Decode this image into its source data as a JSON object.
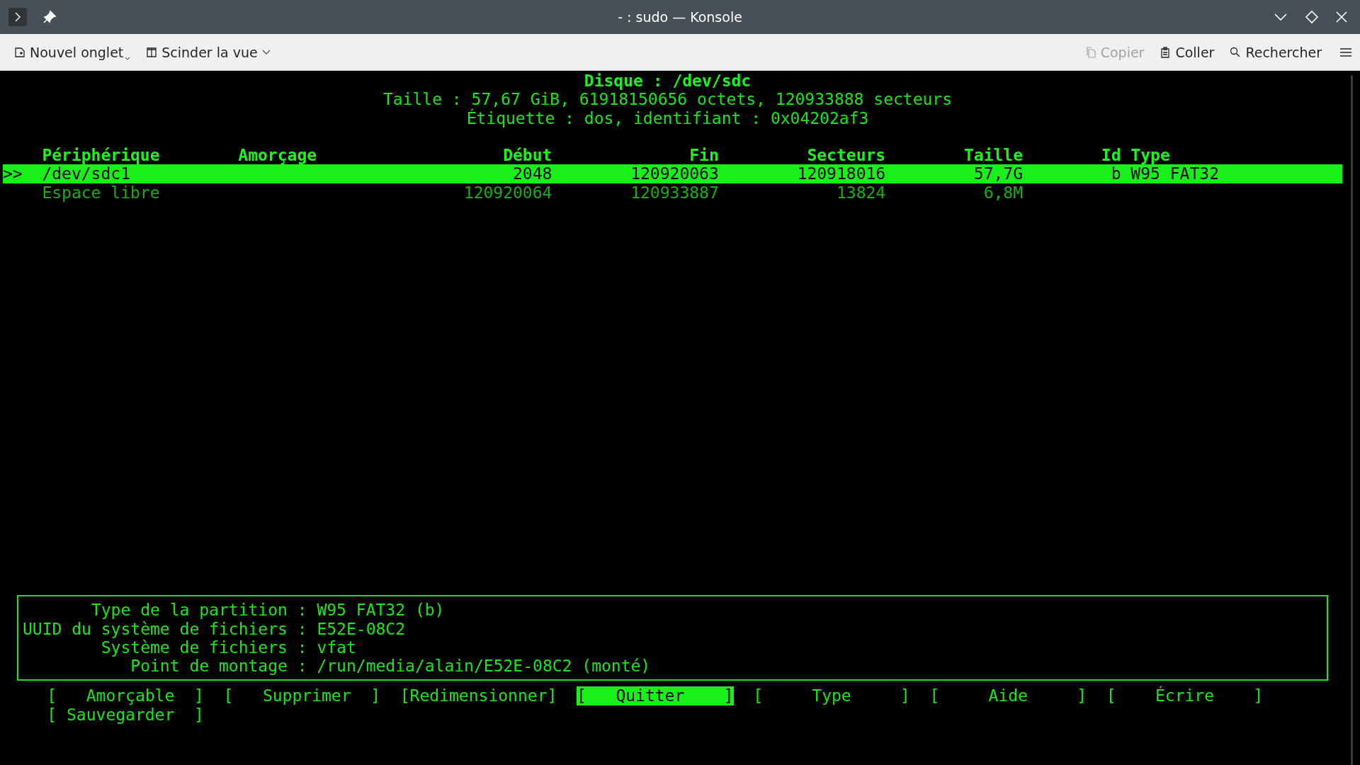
{
  "window": {
    "title": "- : sudo — Konsole"
  },
  "toolbar": {
    "left": [
      {
        "kind": "new-tab",
        "label": "Nouvel onglet",
        "disabled": false
      },
      {
        "kind": "split",
        "label": "Scinder la vue",
        "disabled": false
      }
    ],
    "right": [
      {
        "kind": "copy",
        "label": "Copier",
        "disabled": true
      },
      {
        "kind": "paste",
        "label": "Coller",
        "disabled": false
      },
      {
        "kind": "search",
        "label": "Rechercher",
        "disabled": false
      }
    ]
  },
  "disk": {
    "title": "Disque : /dev/sdc",
    "lines": [
      "Taille : 57,67 GiB, 61918150656 octets, 120933888 secteurs",
      "Étiquette : dos, identifiant : 0x04202af3"
    ]
  },
  "table": {
    "cursor": ">>",
    "columns": [
      "Périphérique",
      "Amorçage",
      "Début",
      "Fin",
      "Secteurs",
      "Taille",
      "Id",
      "Type"
    ],
    "rows": [
      {
        "kind": "partition",
        "selected": true,
        "device": "/dev/sdc1",
        "start": "2048",
        "end": "120920063",
        "sectors": "120918016",
        "size": "57,7G",
        "id": "b",
        "type": "W95 FAT32"
      },
      {
        "kind": "free",
        "selected": false,
        "device": "Espace libre",
        "start": "120920064",
        "end": "120933887",
        "sectors": "13824",
        "size": "6,8M"
      }
    ]
  },
  "details": [
    {
      "label": "Type de la partition :",
      "value": "W95 FAT32 (b)"
    },
    {
      "label": "UUID du système de fichiers :",
      "value": "E52E-08C2"
    },
    {
      "label": "Système de fichiers :",
      "value": "vfat"
    },
    {
      "label": "Point de montage :",
      "value": "/run/media/alain/E52E-08C2 (monté)"
    }
  ],
  "buttons": [
    {
      "label": "[   Amorçable  ]",
      "selected": false
    },
    {
      "label": "[   Supprimer  ]",
      "selected": false
    },
    {
      "label": "[Redimensionner]",
      "selected": false
    },
    {
      "label": "[   Quitter    ]",
      "selected": true
    },
    {
      "label": "[     Type     ]",
      "selected": false
    },
    {
      "label": "[     Aide     ]",
      "selected": false
    },
    {
      "label": "[    Écrire    ]",
      "selected": false
    },
    {
      "label": "[ Sauvegarder  ]",
      "selected": false
    }
  ]
}
